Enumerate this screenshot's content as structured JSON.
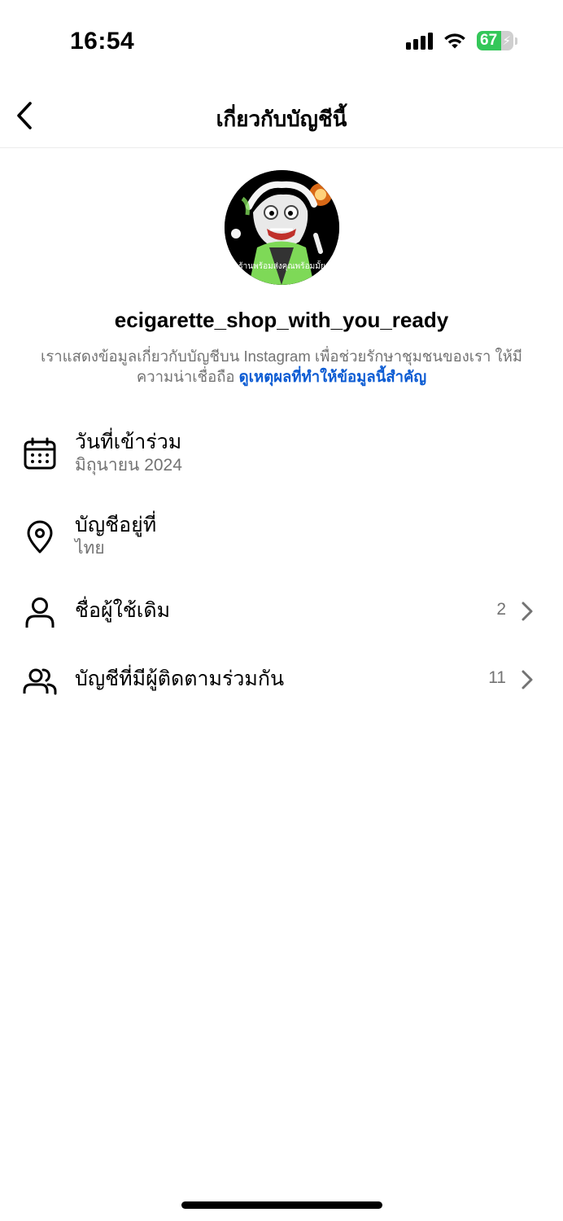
{
  "status_bar": {
    "time": "16:54",
    "battery_level": "67",
    "battery_percent": 67,
    "battery_color": "#34c759",
    "icons": [
      "signal-icon",
      "wifi-icon",
      "battery-charging-icon"
    ]
  },
  "header": {
    "title": "เกี่ยวกับบัญชีนี้",
    "back_icon": "chevron-left-icon"
  },
  "profile": {
    "avatar_caption": "ร้านพร้อมส่งคุณพร้อมมั้ย",
    "username": "ecigarette_shop_with_you_ready",
    "description": "เราแสดงข้อมูลเกี่ยวกับบัญชีบน Instagram เพื่อช่วยรักษาชุมชนของเรา ให้มีความน่าเชื่อถือ",
    "description_link": "ดูเหตุผลที่ทำให้ข้อมูลนี้สำคัญ",
    "link_color": "#0b5bd3"
  },
  "rows": [
    {
      "icon": "calendar-icon",
      "title": "วันที่เข้าร่วม",
      "subtitle": "มิถุนายน 2024"
    },
    {
      "icon": "location-pin-icon",
      "title": "บัญชีอยู่ที่",
      "subtitle": "ไทย"
    },
    {
      "icon": "person-icon",
      "title": "ชื่อผู้ใช้เดิม",
      "count": "2"
    },
    {
      "icon": "people-icon",
      "title": "บัญชีที่มีผู้ติดตามร่วมกัน",
      "count": "11"
    }
  ]
}
